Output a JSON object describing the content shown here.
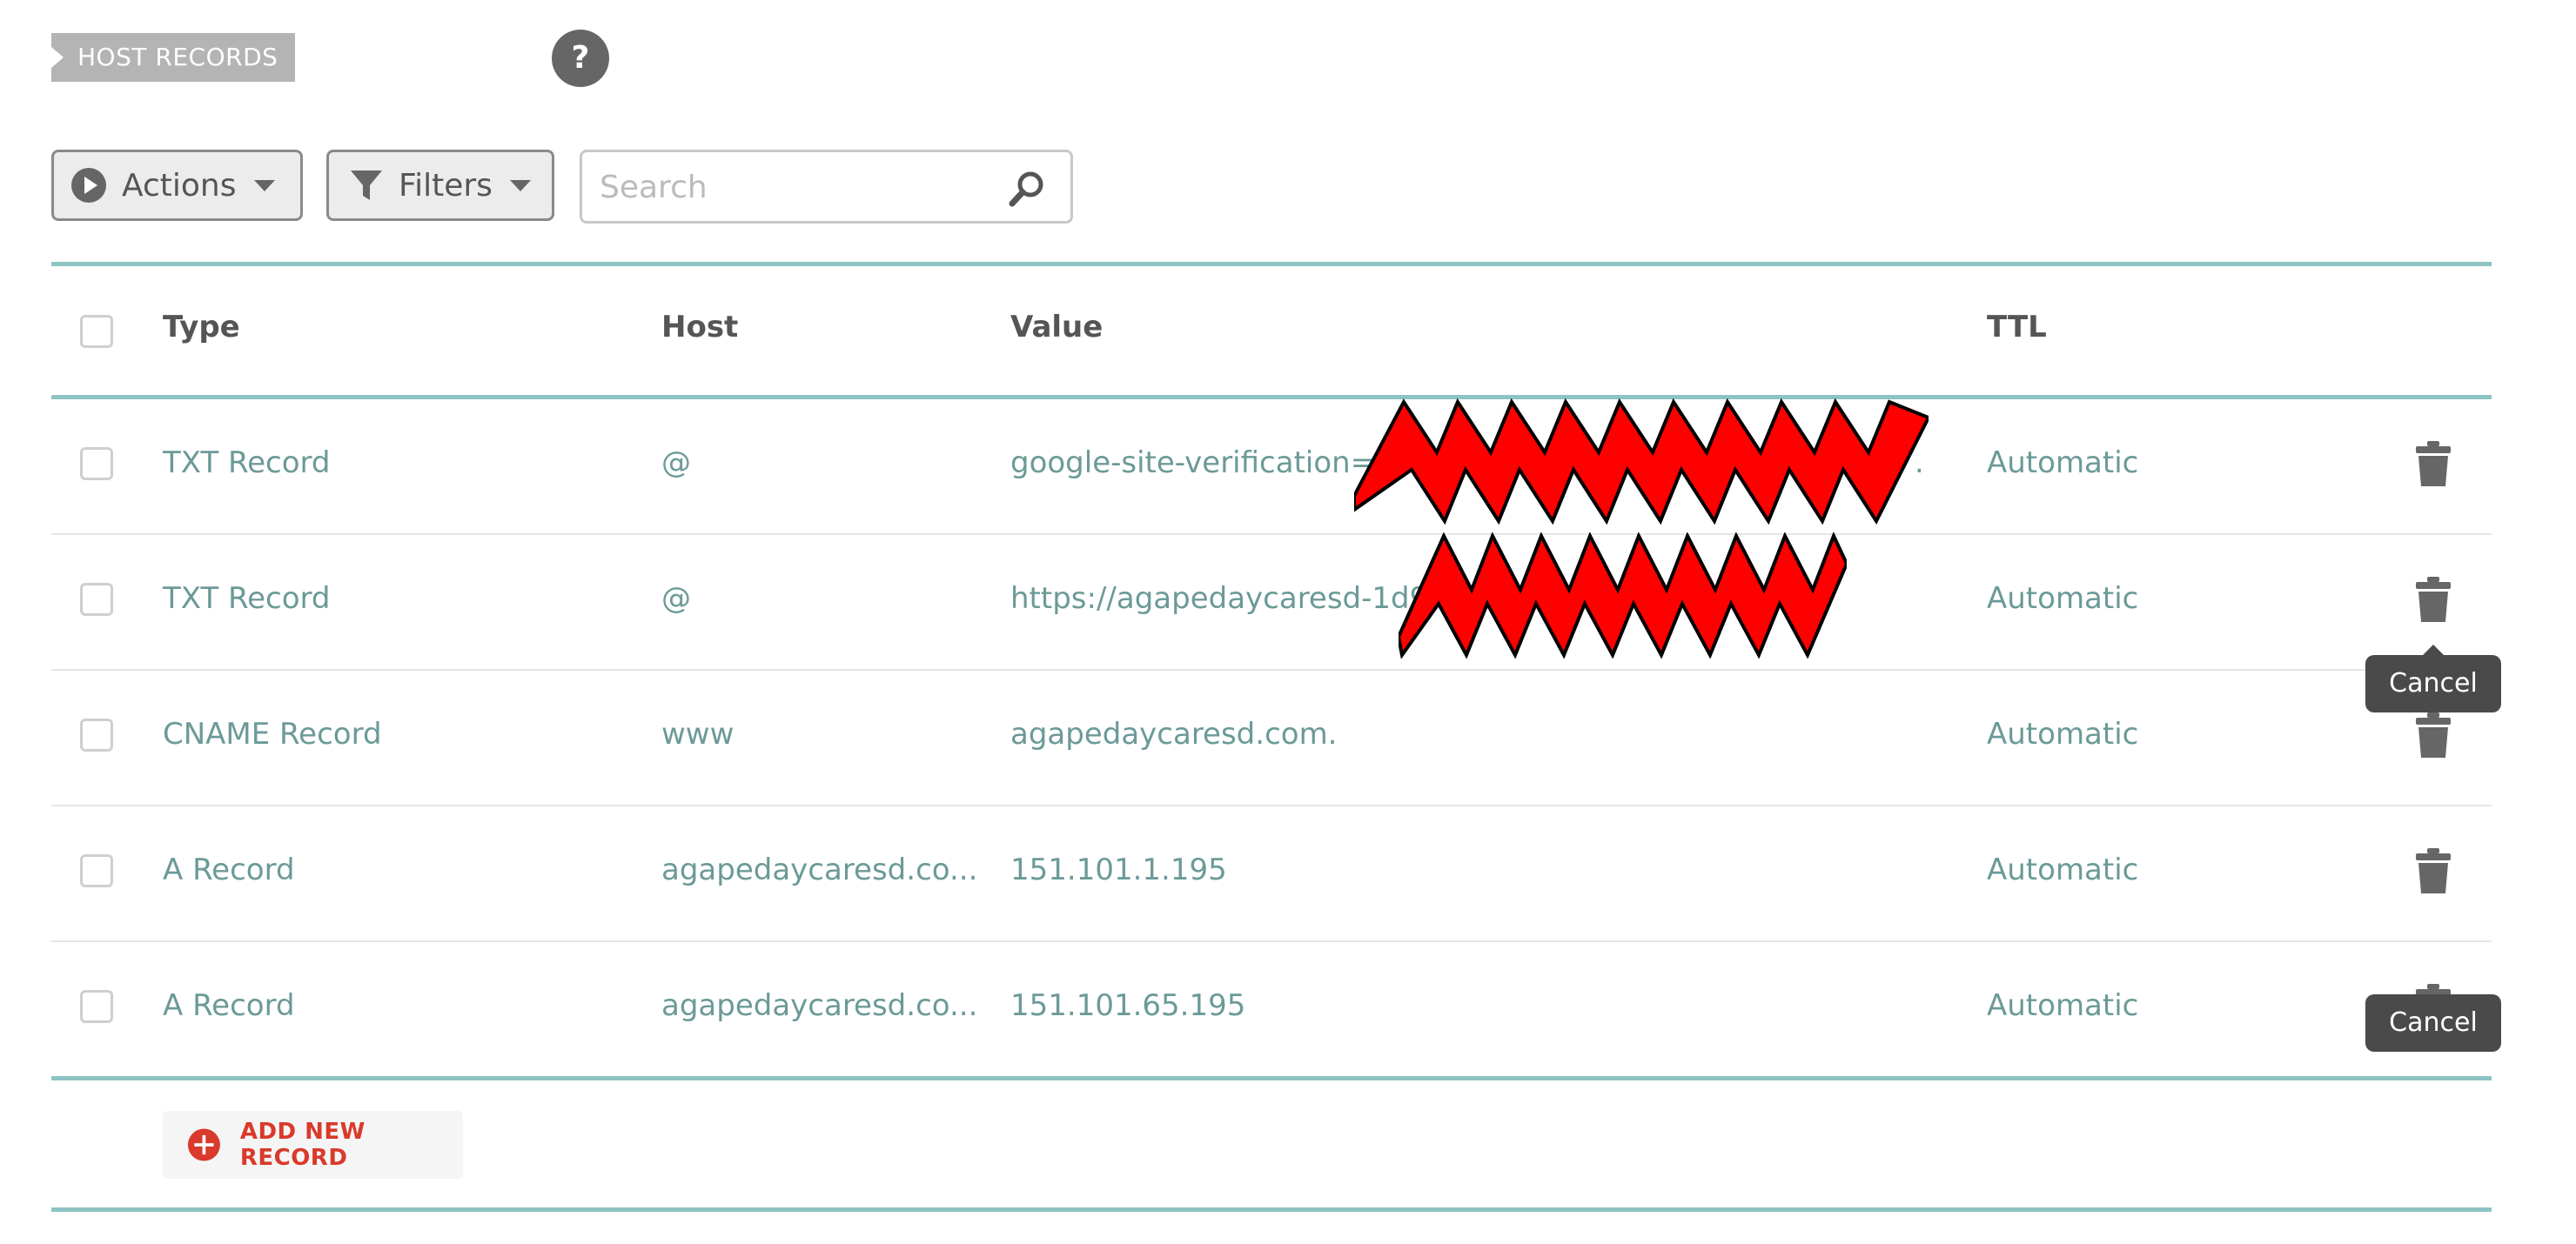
{
  "section": {
    "title": "HOST RECORDS",
    "help_label": "?"
  },
  "toolbar": {
    "actions_label": "Actions",
    "filters_label": "Filters",
    "search_placeholder": "Search"
  },
  "table": {
    "headers": {
      "type": "Type",
      "host": "Host",
      "value": "Value",
      "ttl": "TTL"
    },
    "rows": [
      {
        "type": "TXT Record",
        "host": "@",
        "value": "google-site-verification=",
        "value_tail": ".",
        "ttl": "Automatic"
      },
      {
        "type": "TXT Record",
        "host": "@",
        "value": "https://agapedaycaresd-1d9",
        "value_tail": "",
        "ttl": "Automatic"
      },
      {
        "type": "CNAME Record",
        "host": "www",
        "value": "agapedaycaresd.com.",
        "value_tail": "",
        "ttl": "Automatic"
      },
      {
        "type": "A Record",
        "host": "agapedaycaresd.co...",
        "value": "151.101.1.195",
        "value_tail": "",
        "ttl": "Automatic"
      },
      {
        "type": "A Record",
        "host": "agapedaycaresd.co...",
        "value": "151.101.65.195",
        "value_tail": "",
        "ttl": "Automatic"
      }
    ]
  },
  "tooltips": {
    "cancel_1": "Cancel",
    "cancel_2": "Cancel"
  },
  "add_record": {
    "label": "ADD NEW RECORD"
  },
  "colors": {
    "accent_teal": "#8dc3c3",
    "cell_text": "#6b9a98",
    "add_red": "#d93a2b",
    "redaction_red": "#ff0000"
  },
  "icons": [
    "help-icon",
    "play-icon",
    "filter-icon",
    "chevron-down-icon",
    "search-icon",
    "trash-icon",
    "add-circle-icon"
  ]
}
